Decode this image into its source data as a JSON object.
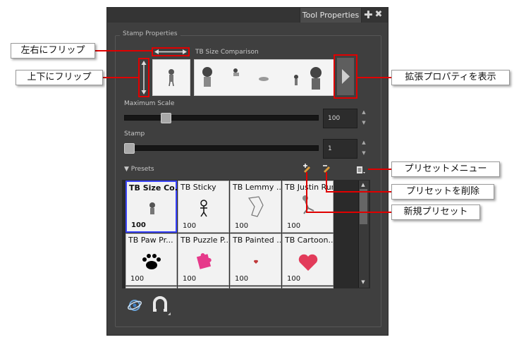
{
  "panel": {
    "tab_title": "Tool Properties",
    "add_symbol": "✚",
    "close_symbol": "✖",
    "group_label": "Stamp Properties"
  },
  "stamp": {
    "comparison_label": "TB Size Comparison",
    "maximum_scale_label": "Maximum Scale",
    "maximum_scale_value": "100",
    "maximum_scale_fraction": 0.2,
    "stamp_label": "Stamp",
    "stamp_value": "1",
    "stamp_fraction": 0.0
  },
  "presets": {
    "label": "Presets",
    "items": [
      {
        "name": "TB Size Co...",
        "size": "100",
        "selected": true,
        "icon": "figure-icon"
      },
      {
        "name": "TB Sticky",
        "size": "100",
        "selected": false,
        "icon": "stick-figure-icon"
      },
      {
        "name": "TB Lemmy ...",
        "size": "100",
        "selected": false,
        "icon": "lemmy-icon"
      },
      {
        "name": "TB Justin Run",
        "size": "100",
        "selected": false,
        "icon": "runner-icon"
      },
      {
        "name": "TB Paw Pr...",
        "size": "100",
        "selected": false,
        "icon": "paw-icon"
      },
      {
        "name": "TB Puzzle P...",
        "size": "100",
        "selected": false,
        "icon": "puzzle-icon"
      },
      {
        "name": "TB Painted ...",
        "size": "100",
        "selected": false,
        "icon": "small-heart-icon"
      },
      {
        "name": "TB Cartoon...",
        "size": "100",
        "selected": false,
        "icon": "heart-icon"
      }
    ]
  },
  "callouts": {
    "flip_horizontal": "左右にフリップ",
    "flip_vertical": "上下にフリップ",
    "show_extended": "拡張プロパティを表示",
    "preset_menu": "プリセットメニュー",
    "delete_preset": "プリセットを削除",
    "new_preset": "新規プリセット"
  },
  "colors": {
    "panel_bg": "#3f3f3f",
    "highlight_red": "#e00000",
    "selection_blue": "#3b45ff"
  }
}
